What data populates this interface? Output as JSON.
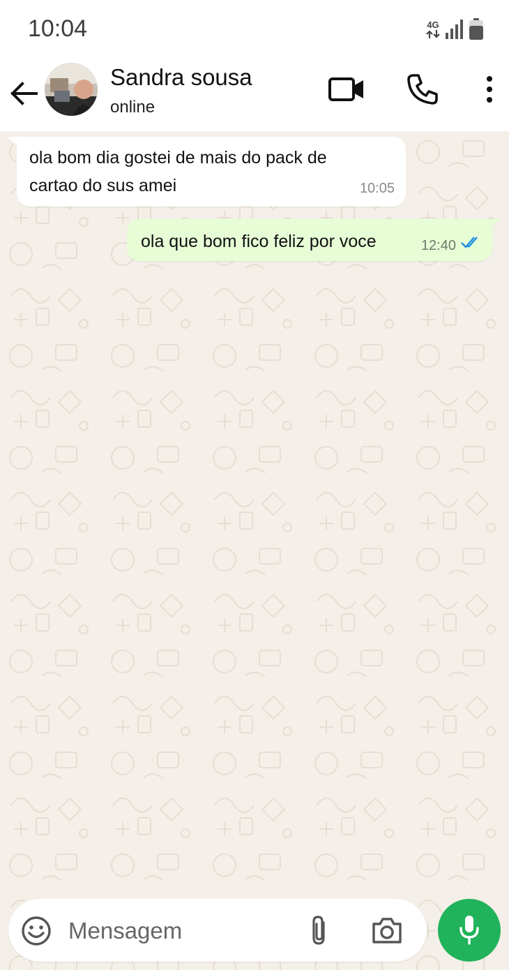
{
  "status_bar": {
    "time": "10:04",
    "network_label": "4G",
    "icons": [
      "data-arrows-icon",
      "signal-icon",
      "battery-icon"
    ]
  },
  "header": {
    "contact_name": "Sandra sousa",
    "contact_status": "online",
    "icons": [
      "back-arrow-icon",
      "avatar",
      "video-call-icon",
      "voice-call-icon",
      "more-options-icon"
    ]
  },
  "messages": [
    {
      "direction": "incoming",
      "text": "ola bom dia gostei de mais do pack de cartao do sus amei",
      "time": "10:05"
    },
    {
      "direction": "outgoing",
      "text": "ola que bom fico feliz por voce",
      "time": "12:40",
      "status": "read"
    }
  ],
  "composer": {
    "placeholder": "Mensagem",
    "icons": [
      "emoji-icon",
      "attach-icon",
      "camera-icon",
      "mic-icon"
    ]
  },
  "colors": {
    "wallpaper": "#f4efe8",
    "incoming_bubble": "#ffffff",
    "outgoing_bubble": "#e7fdd6",
    "read_ticks": "#1a8fe3",
    "mic_button": "#21b35b"
  }
}
